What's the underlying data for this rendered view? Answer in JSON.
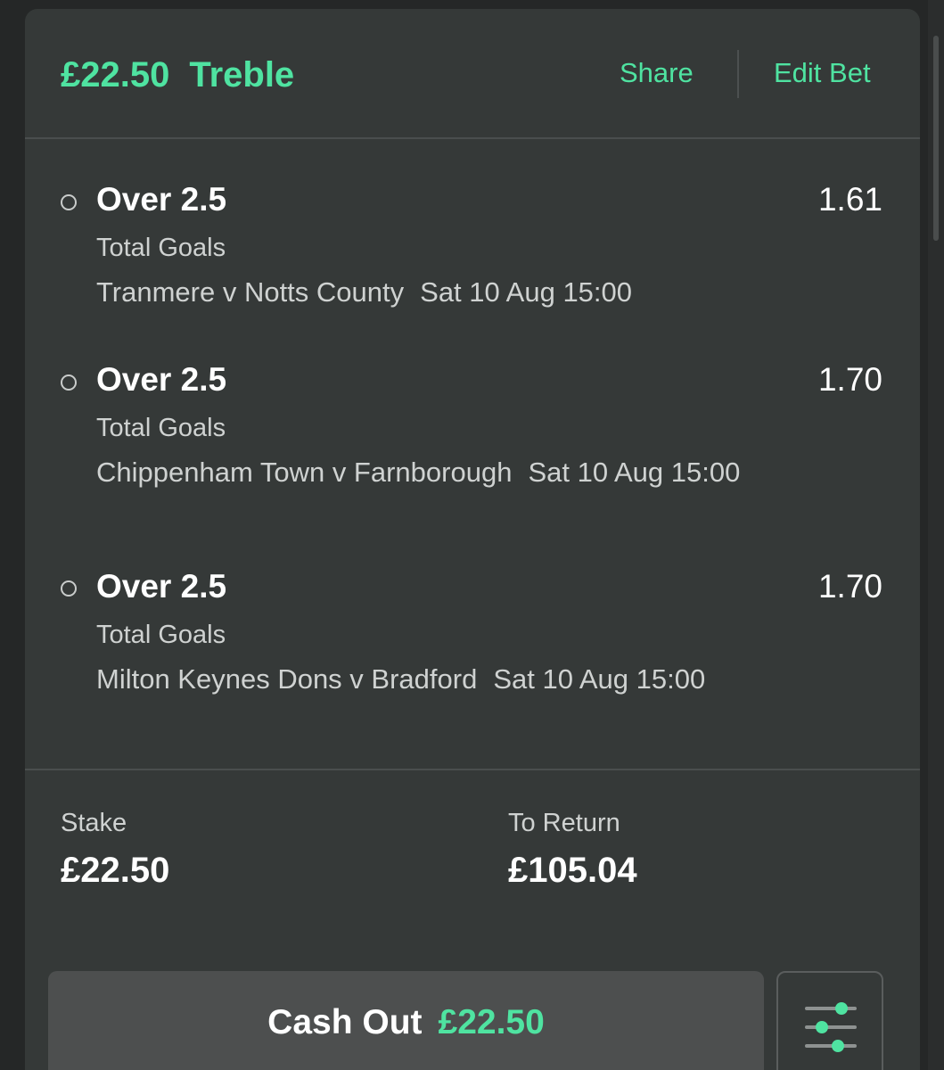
{
  "bet": {
    "stake_title": "£22.50",
    "type": "Treble",
    "share_label": "Share",
    "edit_label": "Edit Bet"
  },
  "selections": [
    {
      "name": "Over 2.5",
      "odds": "1.61",
      "market": "Total Goals",
      "event": "Tranmere v Notts County",
      "time": "Sat 10 Aug 15:00"
    },
    {
      "name": "Over 2.5",
      "odds": "1.70",
      "market": "Total Goals",
      "event": "Chippenham Town v Farnborough",
      "time": "Sat 10 Aug 15:00"
    },
    {
      "name": "Over 2.5",
      "odds": "1.70",
      "market": "Total Goals",
      "event": "Milton Keynes Dons v Bradford",
      "time": "Sat 10 Aug 15:00"
    }
  ],
  "summary": {
    "stake_label": "Stake",
    "stake_value": "£22.50",
    "return_label": "To Return",
    "return_value": "£105.04"
  },
  "cashout": {
    "label": "Cash Out",
    "amount": "£22.50"
  },
  "icons": {
    "settings": "sliders-icon",
    "status": "pending-circle-icon"
  },
  "colors": {
    "accent": "#4fe3a1",
    "card": "#353938",
    "background": "#252727"
  }
}
